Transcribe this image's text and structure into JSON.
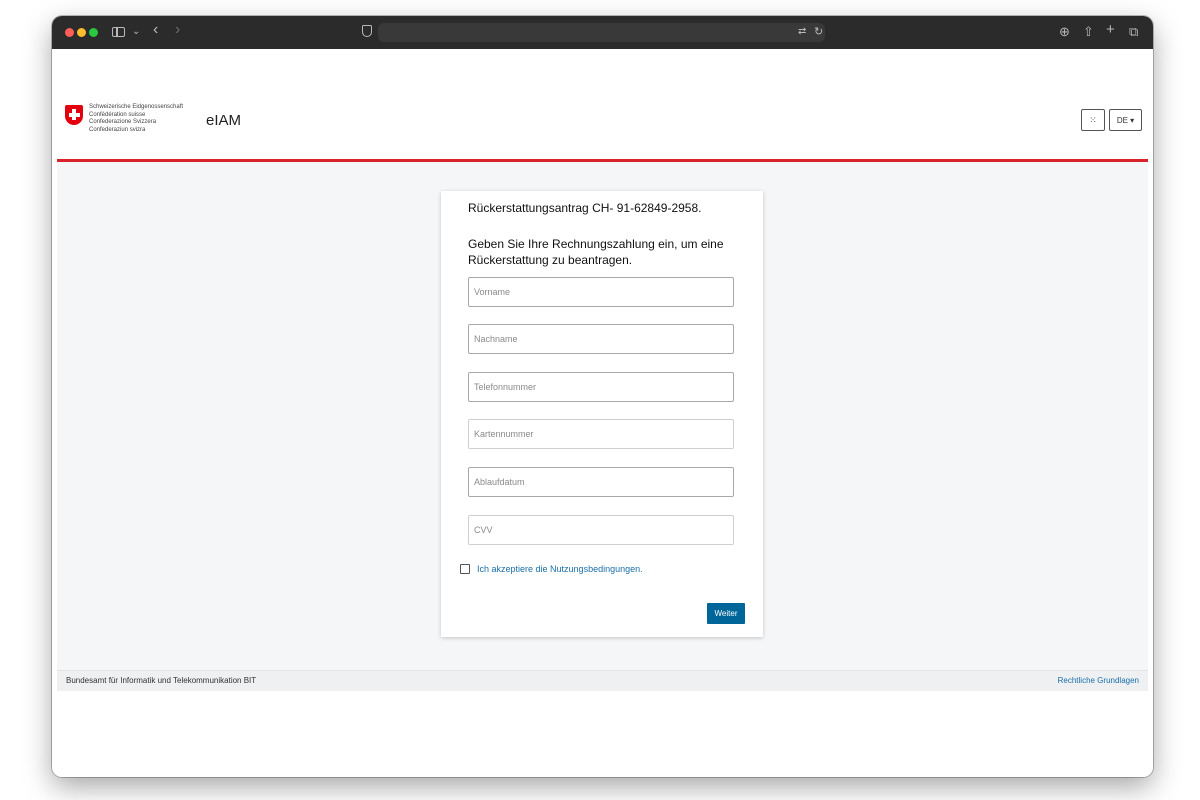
{
  "browser": {
    "toolbar_icons": [
      "sidebar-icon",
      "chevron-down-icon",
      "back-icon",
      "forward-icon",
      "shield-icon",
      "translate-icon",
      "reload-icon",
      "download-icon",
      "share-icon",
      "plus-icon",
      "tabs-icon"
    ],
    "translate_glyph": "⇄",
    "reload_glyph": "↻",
    "back_glyph": "‹",
    "forward_glyph": "›",
    "chevron_glyph": "⌄",
    "download_glyph": "⊕",
    "share_glyph": "⇧",
    "plus_glyph": "+",
    "tabs_glyph": "⧉"
  },
  "header": {
    "confederation_lines": [
      "Schweizerische Eidgenossenschaft",
      "Confédération suisse",
      "Confederazione Svizzera",
      "Confederaziun svizra"
    ],
    "app_title": "eIAM",
    "grid_glyph": "⁙",
    "language": "DE ▾"
  },
  "form": {
    "heading": "Rückerstattungsantrag CH- 91-62849-2958.",
    "instruction": "Geben Sie Ihre Rechnungszahlung ein, um eine Rückerstattung zu beantragen.",
    "fields": [
      {
        "placeholder": "Vorname"
      },
      {
        "placeholder": "Nachname"
      },
      {
        "placeholder": "Telefonnummer"
      },
      {
        "placeholder": "Kartennummer"
      },
      {
        "placeholder": "Ablaufdatum"
      },
      {
        "placeholder": "CVV"
      }
    ],
    "terms_label": "Ich akzeptiere die Nutzungsbedingungen.",
    "submit_label": "Weiter"
  },
  "footer": {
    "left": "Bundesamt für Informatik und Telekommunikation BIT",
    "right": "Rechtliche Grundlagen"
  },
  "colors": {
    "accent_red": "#d8232a",
    "primary_button": "#006699",
    "link": "#1a6ea8"
  }
}
